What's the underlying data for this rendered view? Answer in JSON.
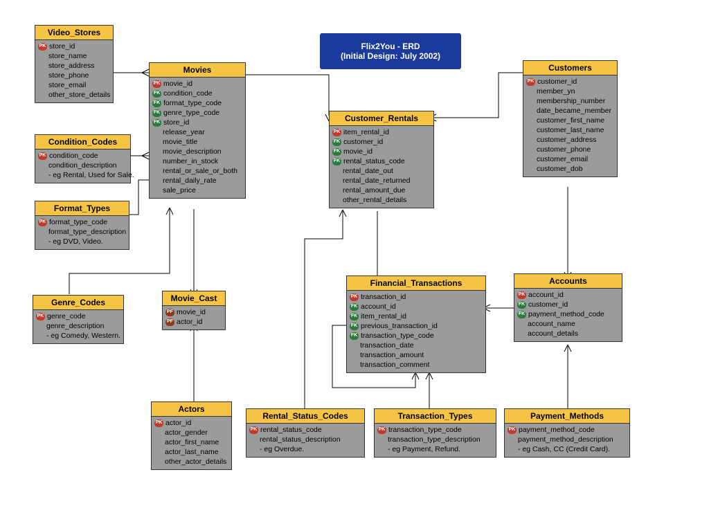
{
  "title": {
    "line1": "Flix2You - ERD",
    "line2": "(Initial Design: July 2002)"
  },
  "key_labels": {
    "pk": "PK",
    "fk": "FK",
    "pf": "PF"
  },
  "entities": {
    "video_stores": {
      "name": "Video_Stores",
      "attrs": [
        {
          "key": "pk",
          "label": "store_id"
        },
        {
          "key": "",
          "label": "store_name"
        },
        {
          "key": "",
          "label": "store_address"
        },
        {
          "key": "",
          "label": "store_phone"
        },
        {
          "key": "",
          "label": "store_email"
        },
        {
          "key": "",
          "label": "other_store_details"
        }
      ]
    },
    "movies": {
      "name": "Movies",
      "attrs": [
        {
          "key": "pk",
          "label": "movie_id"
        },
        {
          "key": "fk",
          "label": "condition_code"
        },
        {
          "key": "fk",
          "label": "format_type_code"
        },
        {
          "key": "fk",
          "label": "genre_type_code"
        },
        {
          "key": "fk",
          "label": "store_id"
        },
        {
          "key": "",
          "label": "release_year"
        },
        {
          "key": "",
          "label": "movie_title"
        },
        {
          "key": "",
          "label": "movie_description"
        },
        {
          "key": "",
          "label": "number_in_stock"
        },
        {
          "key": "",
          "label": "rental_or_sale_or_both"
        },
        {
          "key": "",
          "label": "rental_daily_rate"
        },
        {
          "key": "",
          "label": "sale_price"
        }
      ]
    },
    "condition_codes": {
      "name": "Condition_Codes",
      "attrs": [
        {
          "key": "pk",
          "label": "condition_code"
        },
        {
          "key": "",
          "label": "condition_description"
        },
        {
          "key": "",
          "label": "- eg Rental, Used for Sale."
        }
      ]
    },
    "format_types": {
      "name": "Format_Types",
      "attrs": [
        {
          "key": "pk",
          "label": "format_type_code"
        },
        {
          "key": "",
          "label": "format_type_description"
        },
        {
          "key": "",
          "label": "- eg DVD, Video."
        }
      ]
    },
    "genre_codes": {
      "name": "Genre_Codes",
      "attrs": [
        {
          "key": "pk",
          "label": "genre_code"
        },
        {
          "key": "",
          "label": "genre_description"
        },
        {
          "key": "",
          "label": "- eg Comedy, Western."
        }
      ]
    },
    "movie_cast": {
      "name": "Movie_Cast",
      "attrs": [
        {
          "key": "pf",
          "label": "movie_id"
        },
        {
          "key": "pf",
          "label": "actor_id"
        }
      ]
    },
    "actors": {
      "name": "Actors",
      "attrs": [
        {
          "key": "pk",
          "label": "actor_id"
        },
        {
          "key": "",
          "label": "actor_gender"
        },
        {
          "key": "",
          "label": "actor_first_name"
        },
        {
          "key": "",
          "label": "actor_last_name"
        },
        {
          "key": "",
          "label": "other_actor_details"
        }
      ]
    },
    "customer_rentals": {
      "name": "Customer_Rentals",
      "attrs": [
        {
          "key": "pk",
          "label": "item_rental_id"
        },
        {
          "key": "fk",
          "label": "customer_id"
        },
        {
          "key": "fk",
          "label": "movie_id"
        },
        {
          "key": "fk",
          "label": "rental_status_code"
        },
        {
          "key": "",
          "label": "rental_date_out"
        },
        {
          "key": "",
          "label": "rental_date_returned"
        },
        {
          "key": "",
          "label": "rental_amount_due"
        },
        {
          "key": "",
          "label": "other_rental_details"
        }
      ]
    },
    "customers": {
      "name": "Customers",
      "attrs": [
        {
          "key": "pk",
          "label": "customer_id"
        },
        {
          "key": "",
          "label": "member_yn"
        },
        {
          "key": "",
          "label": "membership_number"
        },
        {
          "key": "",
          "label": "date_became_member"
        },
        {
          "key": "",
          "label": "customer_first_name"
        },
        {
          "key": "",
          "label": "customer_last_name"
        },
        {
          "key": "",
          "label": "customer_address"
        },
        {
          "key": "",
          "label": "customer_phone"
        },
        {
          "key": "",
          "label": "customer_email"
        },
        {
          "key": "",
          "label": "customer_dob"
        }
      ]
    },
    "financial_transactions": {
      "name": "Financial_Transactions",
      "attrs": [
        {
          "key": "pk",
          "label": "transaction_id"
        },
        {
          "key": "fk",
          "label": "account_id"
        },
        {
          "key": "fk",
          "label": "item_rental_id"
        },
        {
          "key": "fk",
          "label": "previous_transaction_id"
        },
        {
          "key": "fk",
          "label": "transaction_type_code"
        },
        {
          "key": "",
          "label": "transaction_date"
        },
        {
          "key": "",
          "label": "transaction_amount"
        },
        {
          "key": "",
          "label": "transaction_comment"
        }
      ]
    },
    "accounts": {
      "name": "Accounts",
      "attrs": [
        {
          "key": "pk",
          "label": "account_id"
        },
        {
          "key": "fk",
          "label": "customer_id"
        },
        {
          "key": "fk",
          "label": "payment_method_code"
        },
        {
          "key": "",
          "label": "account_name"
        },
        {
          "key": "",
          "label": "account_details"
        }
      ]
    },
    "rental_status_codes": {
      "name": "Rental_Status_Codes",
      "attrs": [
        {
          "key": "pk",
          "label": "rental_status_code"
        },
        {
          "key": "",
          "label": "rental_status_description"
        },
        {
          "key": "",
          "label": "- eg Overdue."
        }
      ]
    },
    "transaction_types": {
      "name": "Transaction_Types",
      "attrs": [
        {
          "key": "pk",
          "label": "transaction_type_code"
        },
        {
          "key": "",
          "label": "transaction_type_description"
        },
        {
          "key": "",
          "label": "- eg Payment, Refund."
        }
      ]
    },
    "payment_methods": {
      "name": "Payment_Methods",
      "attrs": [
        {
          "key": "pk",
          "label": "payment_method_code"
        },
        {
          "key": "",
          "label": "payment_method_description"
        },
        {
          "key": "",
          "label": "- eg Cash, CC (Credit Card)."
        }
      ]
    }
  },
  "chart_data": {
    "type": "erd",
    "title": "Flix2You - ERD (Initial Design: July 2002)",
    "entities": [
      "Video_Stores",
      "Movies",
      "Condition_Codes",
      "Format_Types",
      "Genre_Codes",
      "Movie_Cast",
      "Actors",
      "Customer_Rentals",
      "Customers",
      "Financial_Transactions",
      "Accounts",
      "Rental_Status_Codes",
      "Transaction_Types",
      "Payment_Methods"
    ],
    "relationships": [
      {
        "from": "Video_Stores",
        "to": "Movies",
        "type": "one-to-many"
      },
      {
        "from": "Condition_Codes",
        "to": "Movies",
        "type": "one-to-many"
      },
      {
        "from": "Format_Types",
        "to": "Movies",
        "type": "one-to-many"
      },
      {
        "from": "Genre_Codes",
        "to": "Movies",
        "type": "one-to-many"
      },
      {
        "from": "Movies",
        "to": "Movie_Cast",
        "type": "one-to-many"
      },
      {
        "from": "Actors",
        "to": "Movie_Cast",
        "type": "one-to-many"
      },
      {
        "from": "Movies",
        "to": "Customer_Rentals",
        "type": "one-to-many"
      },
      {
        "from": "Customers",
        "to": "Customer_Rentals",
        "type": "one-to-many"
      },
      {
        "from": "Customer_Rentals",
        "to": "Financial_Transactions",
        "type": "one-to-many"
      },
      {
        "from": "Rental_Status_Codes",
        "to": "Customer_Rentals",
        "type": "one-to-many"
      },
      {
        "from": "Accounts",
        "to": "Financial_Transactions",
        "type": "one-to-many"
      },
      {
        "from": "Financial_Transactions",
        "to": "Financial_Transactions",
        "type": "one-to-many",
        "note": "previous_transaction_id self reference"
      },
      {
        "from": "Customers",
        "to": "Accounts",
        "type": "one-to-many"
      },
      {
        "from": "Transaction_Types",
        "to": "Financial_Transactions",
        "type": "one-to-many"
      },
      {
        "from": "Payment_Methods",
        "to": "Accounts",
        "type": "one-to-many"
      }
    ]
  }
}
